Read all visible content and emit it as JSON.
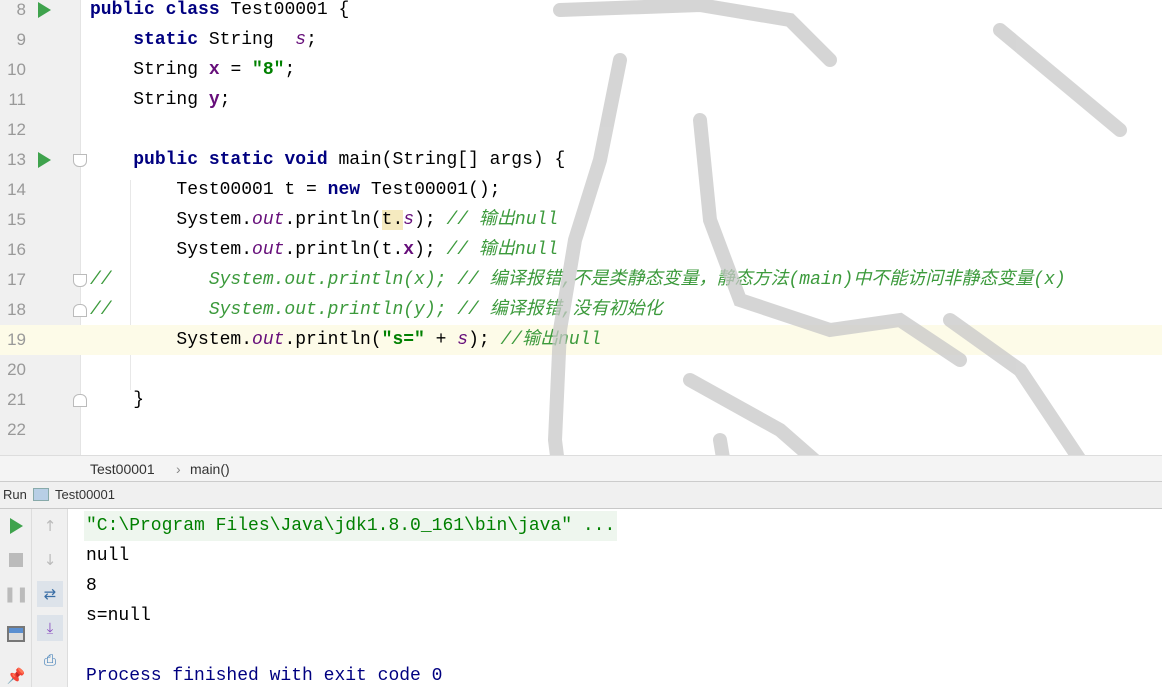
{
  "editor": {
    "lines": [
      {
        "num": "8",
        "run": true,
        "tokens": [
          [
            "kw",
            "public class "
          ],
          [
            "pl",
            "Test00001 {"
          ]
        ]
      },
      {
        "num": "9",
        "tokens": [
          [
            "pl",
            "    "
          ],
          [
            "kw",
            "static "
          ],
          [
            "pl",
            "String  "
          ],
          [
            "sfld",
            "s"
          ],
          [
            "pl",
            ";"
          ]
        ]
      },
      {
        "num": "10",
        "tokens": [
          [
            "pl",
            "    String "
          ],
          [
            "fld",
            "x"
          ],
          [
            "pl",
            " = "
          ],
          [
            "str",
            "\"8\""
          ],
          [
            "pl",
            ";"
          ]
        ]
      },
      {
        "num": "11",
        "tokens": [
          [
            "pl",
            "    String "
          ],
          [
            "fld",
            "y"
          ],
          [
            "pl",
            ";"
          ]
        ]
      },
      {
        "num": "12",
        "tokens": []
      },
      {
        "num": "13",
        "run": true,
        "fold": "start",
        "tokens": [
          [
            "pl",
            "    "
          ],
          [
            "kw",
            "public static void "
          ],
          [
            "pl",
            "main(String[] args) {"
          ]
        ]
      },
      {
        "num": "14",
        "tokens": [
          [
            "pl",
            "        Test00001 t = "
          ],
          [
            "kw",
            "new "
          ],
          [
            "pl",
            "Test00001();"
          ]
        ]
      },
      {
        "num": "15",
        "tokens": [
          [
            "pl",
            "        System."
          ],
          [
            "sfld",
            "out"
          ],
          [
            "pl",
            ".println("
          ],
          [
            "hl",
            "t."
          ],
          [
            "sfld",
            "s"
          ],
          [
            "pl",
            "); "
          ],
          [
            "cm",
            "// 输出null"
          ]
        ]
      },
      {
        "num": "16",
        "tokens": [
          [
            "pl",
            "        System."
          ],
          [
            "sfld",
            "out"
          ],
          [
            "pl",
            ".println(t."
          ],
          [
            "fld",
            "x"
          ],
          [
            "pl",
            "); "
          ],
          [
            "cm",
            "// 输出null"
          ]
        ]
      },
      {
        "num": "17",
        "fold": "start",
        "tokens": [
          [
            "cm",
            "//         System.out.println(x); // 编译报错,不是类静态变量，静态方法(main)中不能访问非静态变量(x)"
          ]
        ]
      },
      {
        "num": "18",
        "fold": "end",
        "tokens": [
          [
            "cm",
            "//         System.out.println(y); // 编译报错,没有初始化"
          ]
        ]
      },
      {
        "num": "19",
        "current": true,
        "tokens": [
          [
            "pl",
            "        System."
          ],
          [
            "sfld",
            "out"
          ],
          [
            "pl",
            ".println("
          ],
          [
            "str",
            "\"s=\""
          ],
          [
            "pl",
            " + "
          ],
          [
            "sfld",
            "s"
          ],
          [
            "pl",
            "); "
          ],
          [
            "cm",
            "//输出null"
          ]
        ]
      },
      {
        "num": "20",
        "tokens": []
      },
      {
        "num": "21",
        "fold": "end",
        "tokens": [
          [
            "pl",
            "    }"
          ]
        ]
      },
      {
        "num": "22",
        "tokens": []
      }
    ]
  },
  "breadcrumb": {
    "class": "Test00001",
    "separator": "›",
    "method": "main()"
  },
  "run_panel": {
    "label": "Run",
    "config": "Test00001"
  },
  "console": {
    "command": "\"C:\\Program Files\\Java\\jdk1.8.0_161\\bin\\java\" ...",
    "output": [
      "null",
      "8",
      "s=null"
    ],
    "exit": "Process finished with exit code 0"
  },
  "colors": {
    "keyword": "#000080",
    "field": "#660e7a",
    "string": "#008000",
    "comment": "#3c9a3c",
    "run": "#3fa34d",
    "current_line": "#fdfbe8"
  }
}
